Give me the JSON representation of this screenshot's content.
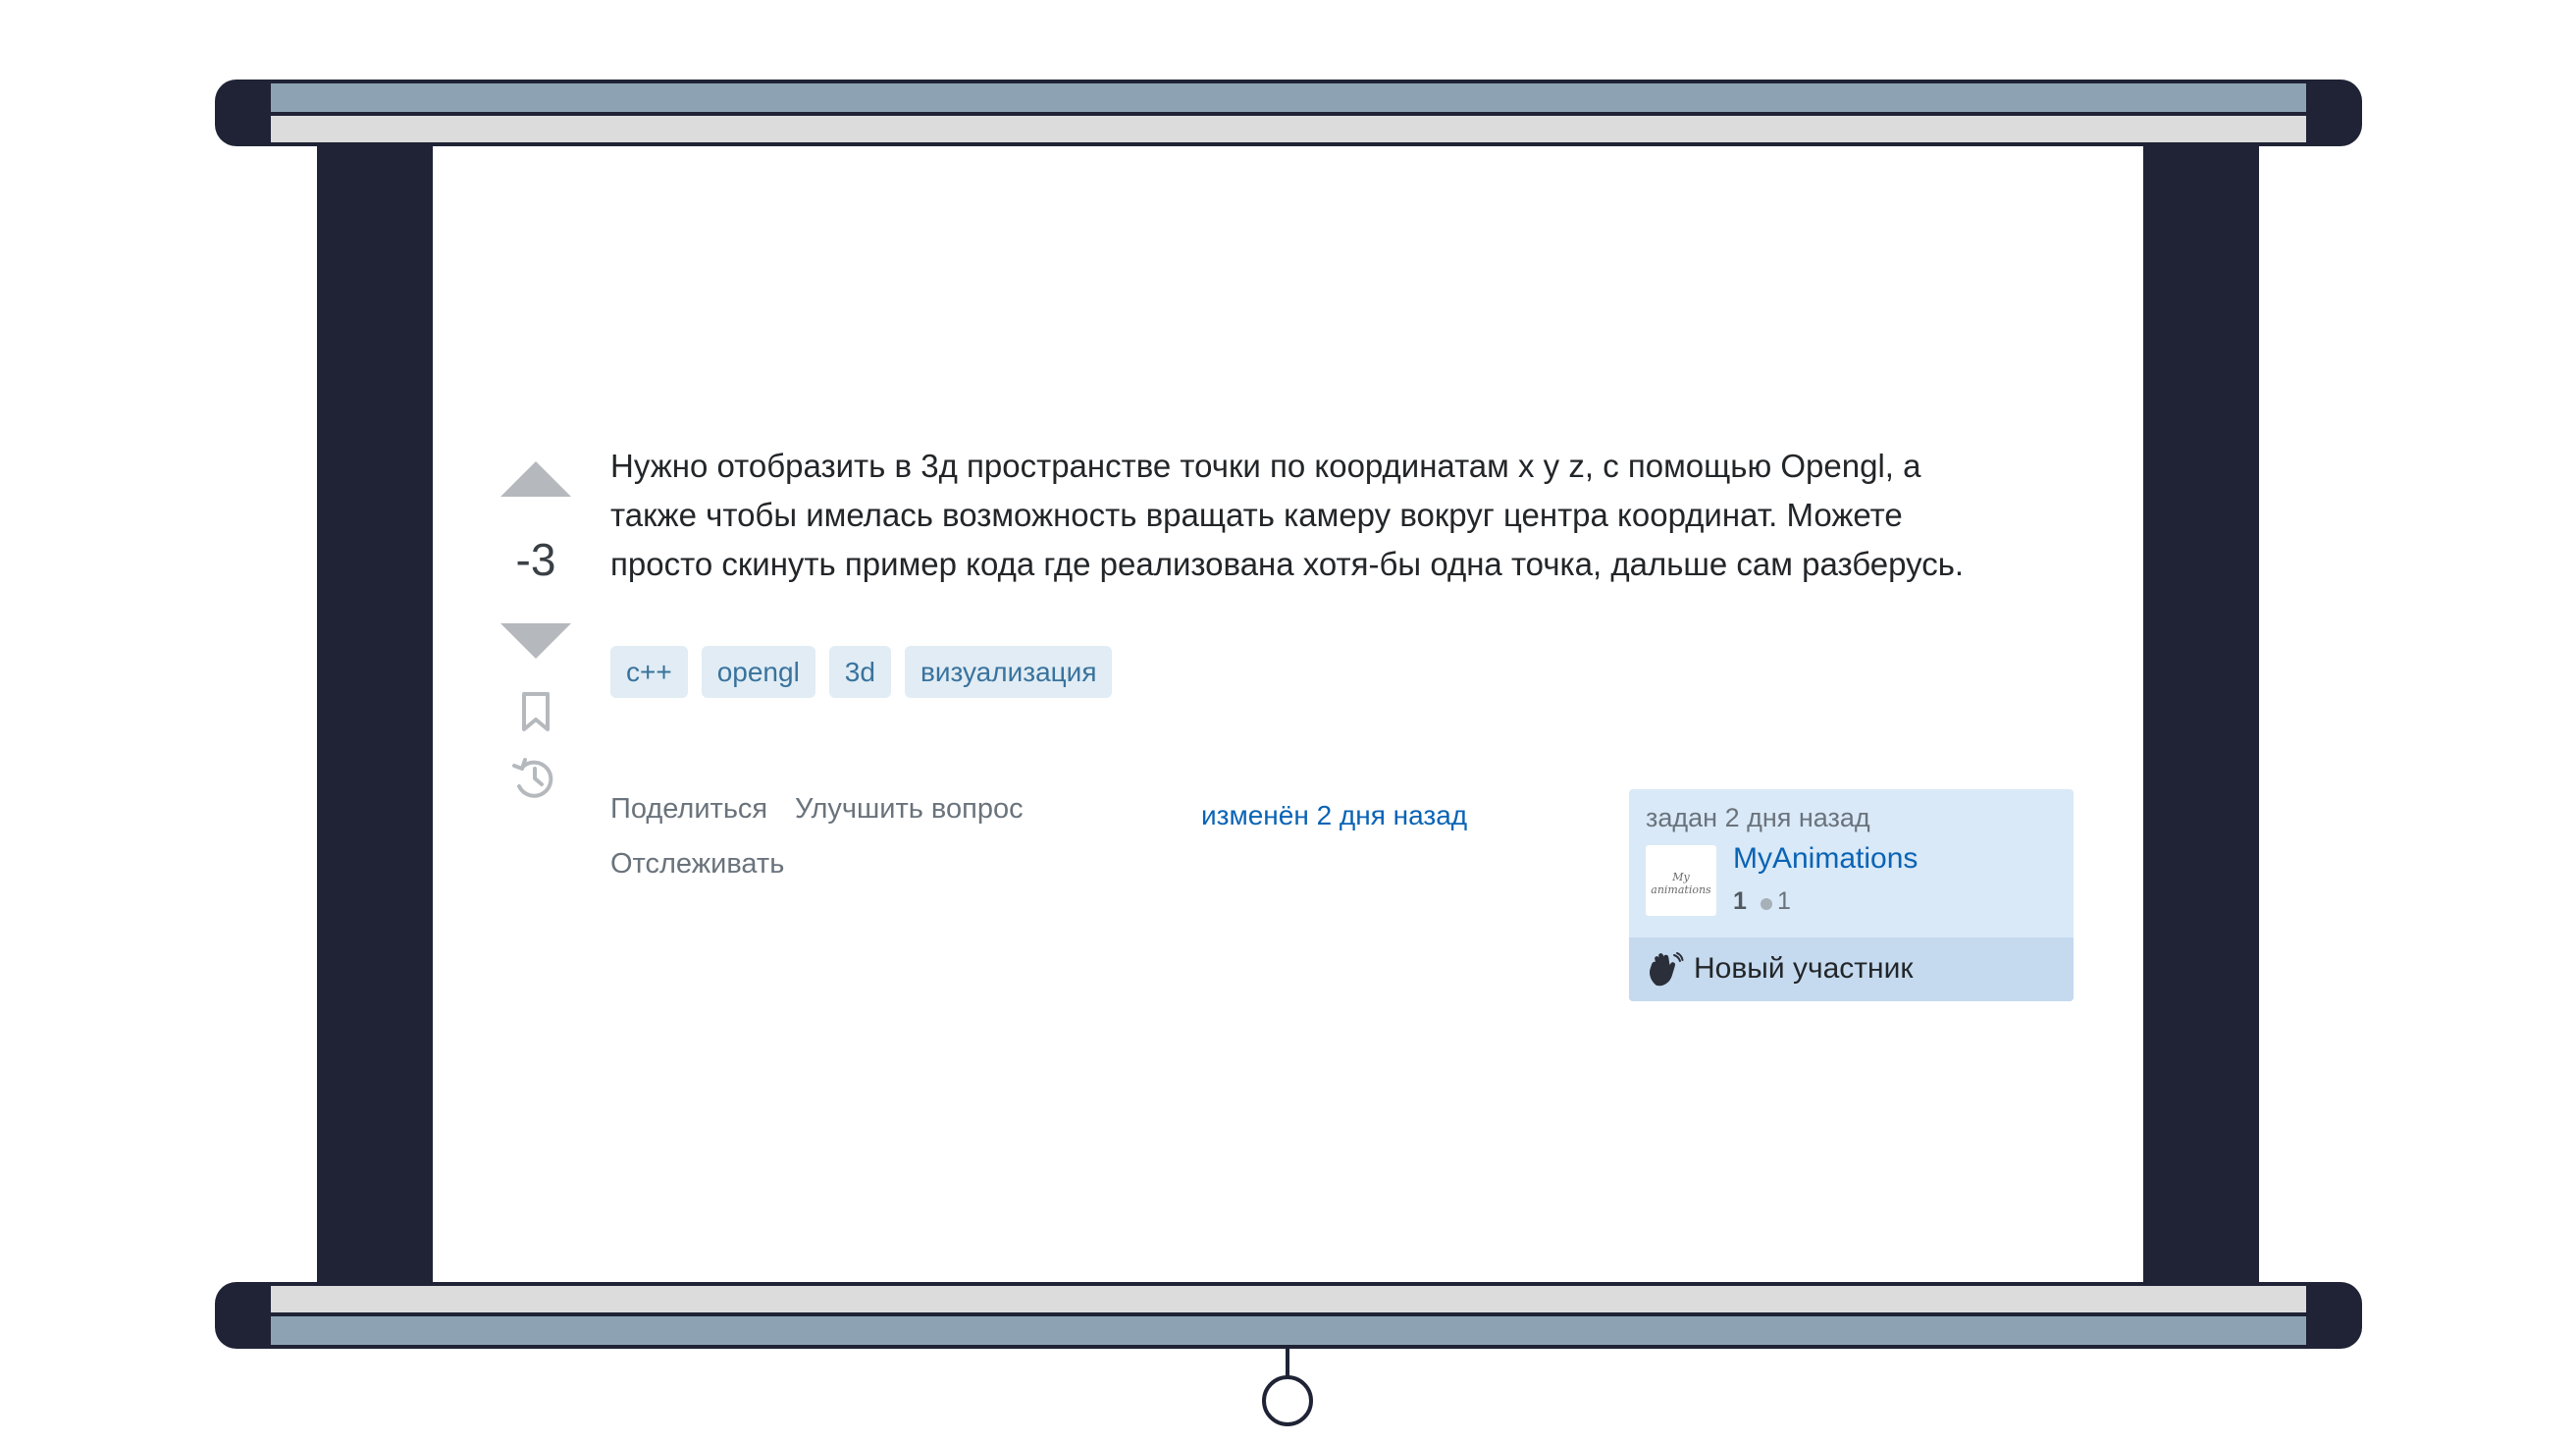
{
  "question": {
    "score": "-3",
    "body_lines": [
      "Нужно отобразить в 3д пространстве точки по координатам x y z, с помощью Opengl, а",
      "также чтобы имелась возможность вращать камеру вокруг центра координат. Можете",
      "просто скинуть пример кода где реализована хотя-бы одна точка, дальше сам разберусь."
    ],
    "tags": [
      "c++",
      "opengl",
      "3d",
      "визуализация"
    ]
  },
  "actions": {
    "share": "Поделиться",
    "improve": "Улучшить вопрос",
    "follow": "Отслеживать",
    "edited": "изменён 2 дня назад"
  },
  "owner": {
    "asked": "задан 2 дня назад",
    "name": "MyAnimations",
    "reputation": "1",
    "bronze_badges": "1",
    "new_contributor_label": "Новый участник"
  },
  "icons": {
    "vote_up": "triangle-up-icon",
    "vote_down": "triangle-down-icon",
    "bookmark": "bookmark-icon",
    "history": "history-icon",
    "new_contributor": "waving-hand-icon"
  },
  "colors": {
    "frame": "#1f2335",
    "tag_bg": "#e1ecf4",
    "tag_text": "#39739d",
    "link": "#0a63b5",
    "owner_card_bg": "#d9e9f7"
  }
}
